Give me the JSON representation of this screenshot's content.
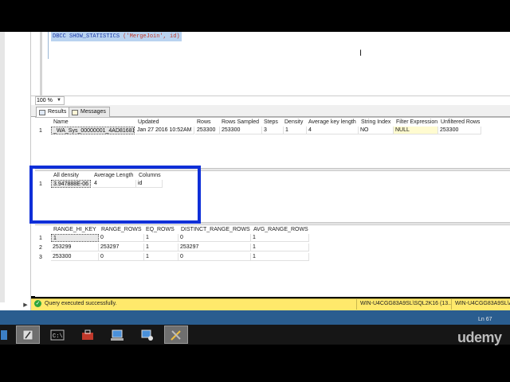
{
  "editor": {
    "code_keyword": "DBCC SHOW_STATISTICS",
    "code_rest": " ('MergeJoin', id)"
  },
  "zoom": {
    "value": "100 %"
  },
  "tabs": [
    {
      "label": "Results",
      "active": true,
      "icon": "results-grid-icon"
    },
    {
      "label": "Messages",
      "active": false,
      "icon": "messages-icon"
    }
  ],
  "header_grid": {
    "columns": [
      "Name",
      "Updated",
      "Rows",
      "Rows Sampled",
      "Steps",
      "Density",
      "Average key length",
      "String Index",
      "Filter Expression",
      "Unfiltered Rows"
    ],
    "rows": [
      {
        "num": "1",
        "cells": [
          "_WA_Sys_00000001_4AD81681",
          "Jan 27 2016 10:52AM",
          "253300",
          "253300",
          "3",
          "1",
          "4",
          "NO",
          "NULL",
          "253300"
        ]
      }
    ]
  },
  "density_grid": {
    "columns": [
      "All density",
      "Average Length",
      "Columns"
    ],
    "rows": [
      {
        "num": "1",
        "cells": [
          "3.947888E-06",
          "4",
          "id"
        ]
      }
    ]
  },
  "histogram_grid": {
    "columns": [
      "RANGE_HI_KEY",
      "RANGE_ROWS",
      "EQ_ROWS",
      "DISTINCT_RANGE_ROWS",
      "AVG_RANGE_ROWS"
    ],
    "rows": [
      {
        "num": "1",
        "cells": [
          "1",
          "0",
          "1",
          "0",
          "1"
        ]
      },
      {
        "num": "2",
        "cells": [
          "253299",
          "253297",
          "1",
          "253297",
          "1"
        ]
      },
      {
        "num": "3",
        "cells": [
          "253300",
          "0",
          "1",
          "0",
          "1"
        ]
      }
    ]
  },
  "status": {
    "message": "Query executed successfully.",
    "server": "WIN-U4CGG83A9SL\\SQL2K16 (13...",
    "user": "WIN-U4CGG83A9SL\\A",
    "color": "#ffe96b"
  },
  "editor_status": {
    "line": "Ln 67"
  },
  "watermark": "udemy",
  "taskbar": {
    "buttons": [
      "server-manager-icon",
      "powershell-icon",
      "command-prompt-icon",
      "toolbox-icon",
      "network-icon",
      "database-connection-icon",
      "ssms-tools-icon"
    ]
  }
}
